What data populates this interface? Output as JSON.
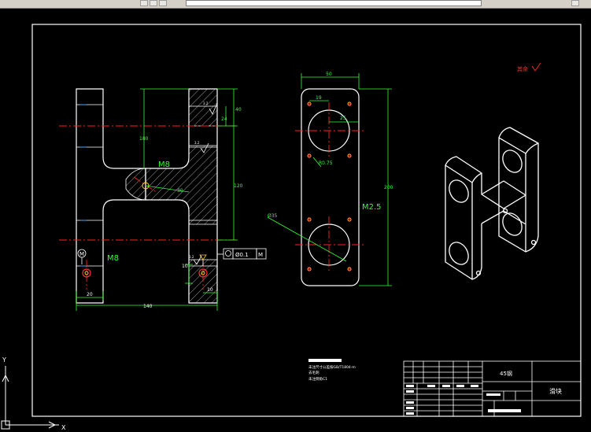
{
  "toolbar": {
    "layer_text": "",
    "icons": [
      "layer-icon",
      "sun-icon",
      "lock-icon",
      "color-icon",
      "dropdown-arrow-icon",
      "down-icon",
      "arrow-icon",
      "close-icon"
    ]
  },
  "drawing": {
    "front_view": {
      "dims": {
        "top_40": "40",
        "top_24": "24",
        "h_180": "180",
        "h_120": "120",
        "web_thk": "30",
        "w_20": "20",
        "w_140": "140",
        "w_10": "10",
        "h_10": "10"
      },
      "labels": {
        "m8_center": "M8",
        "m8_lower": "M8",
        "datum_left": "M",
        "datum_right": "M",
        "flatness_symbol": "Ø0.1",
        "flatness_datum": "M",
        "roughness_1": "3.2",
        "roughness_2": "3.2",
        "roughness_3": "3.2"
      }
    },
    "side_view": {
      "dims": {
        "w_50": "50",
        "w_19": "19",
        "h_200": "200",
        "r_25": "25",
        "r_075": "R0.75",
        "dia_35": "Ø35",
        "thread": "M2.5"
      }
    },
    "roughness_note": "其余",
    "notes": {
      "line1": "未注尺寸公差按GB/T1804-m",
      "line2": "去毛刺",
      "line3": "未注倒角C1"
    },
    "title_block": {
      "material": "45钢",
      "part_name": "滑块"
    }
  },
  "ucs": {
    "y_label": "Y",
    "x_label": "X"
  }
}
